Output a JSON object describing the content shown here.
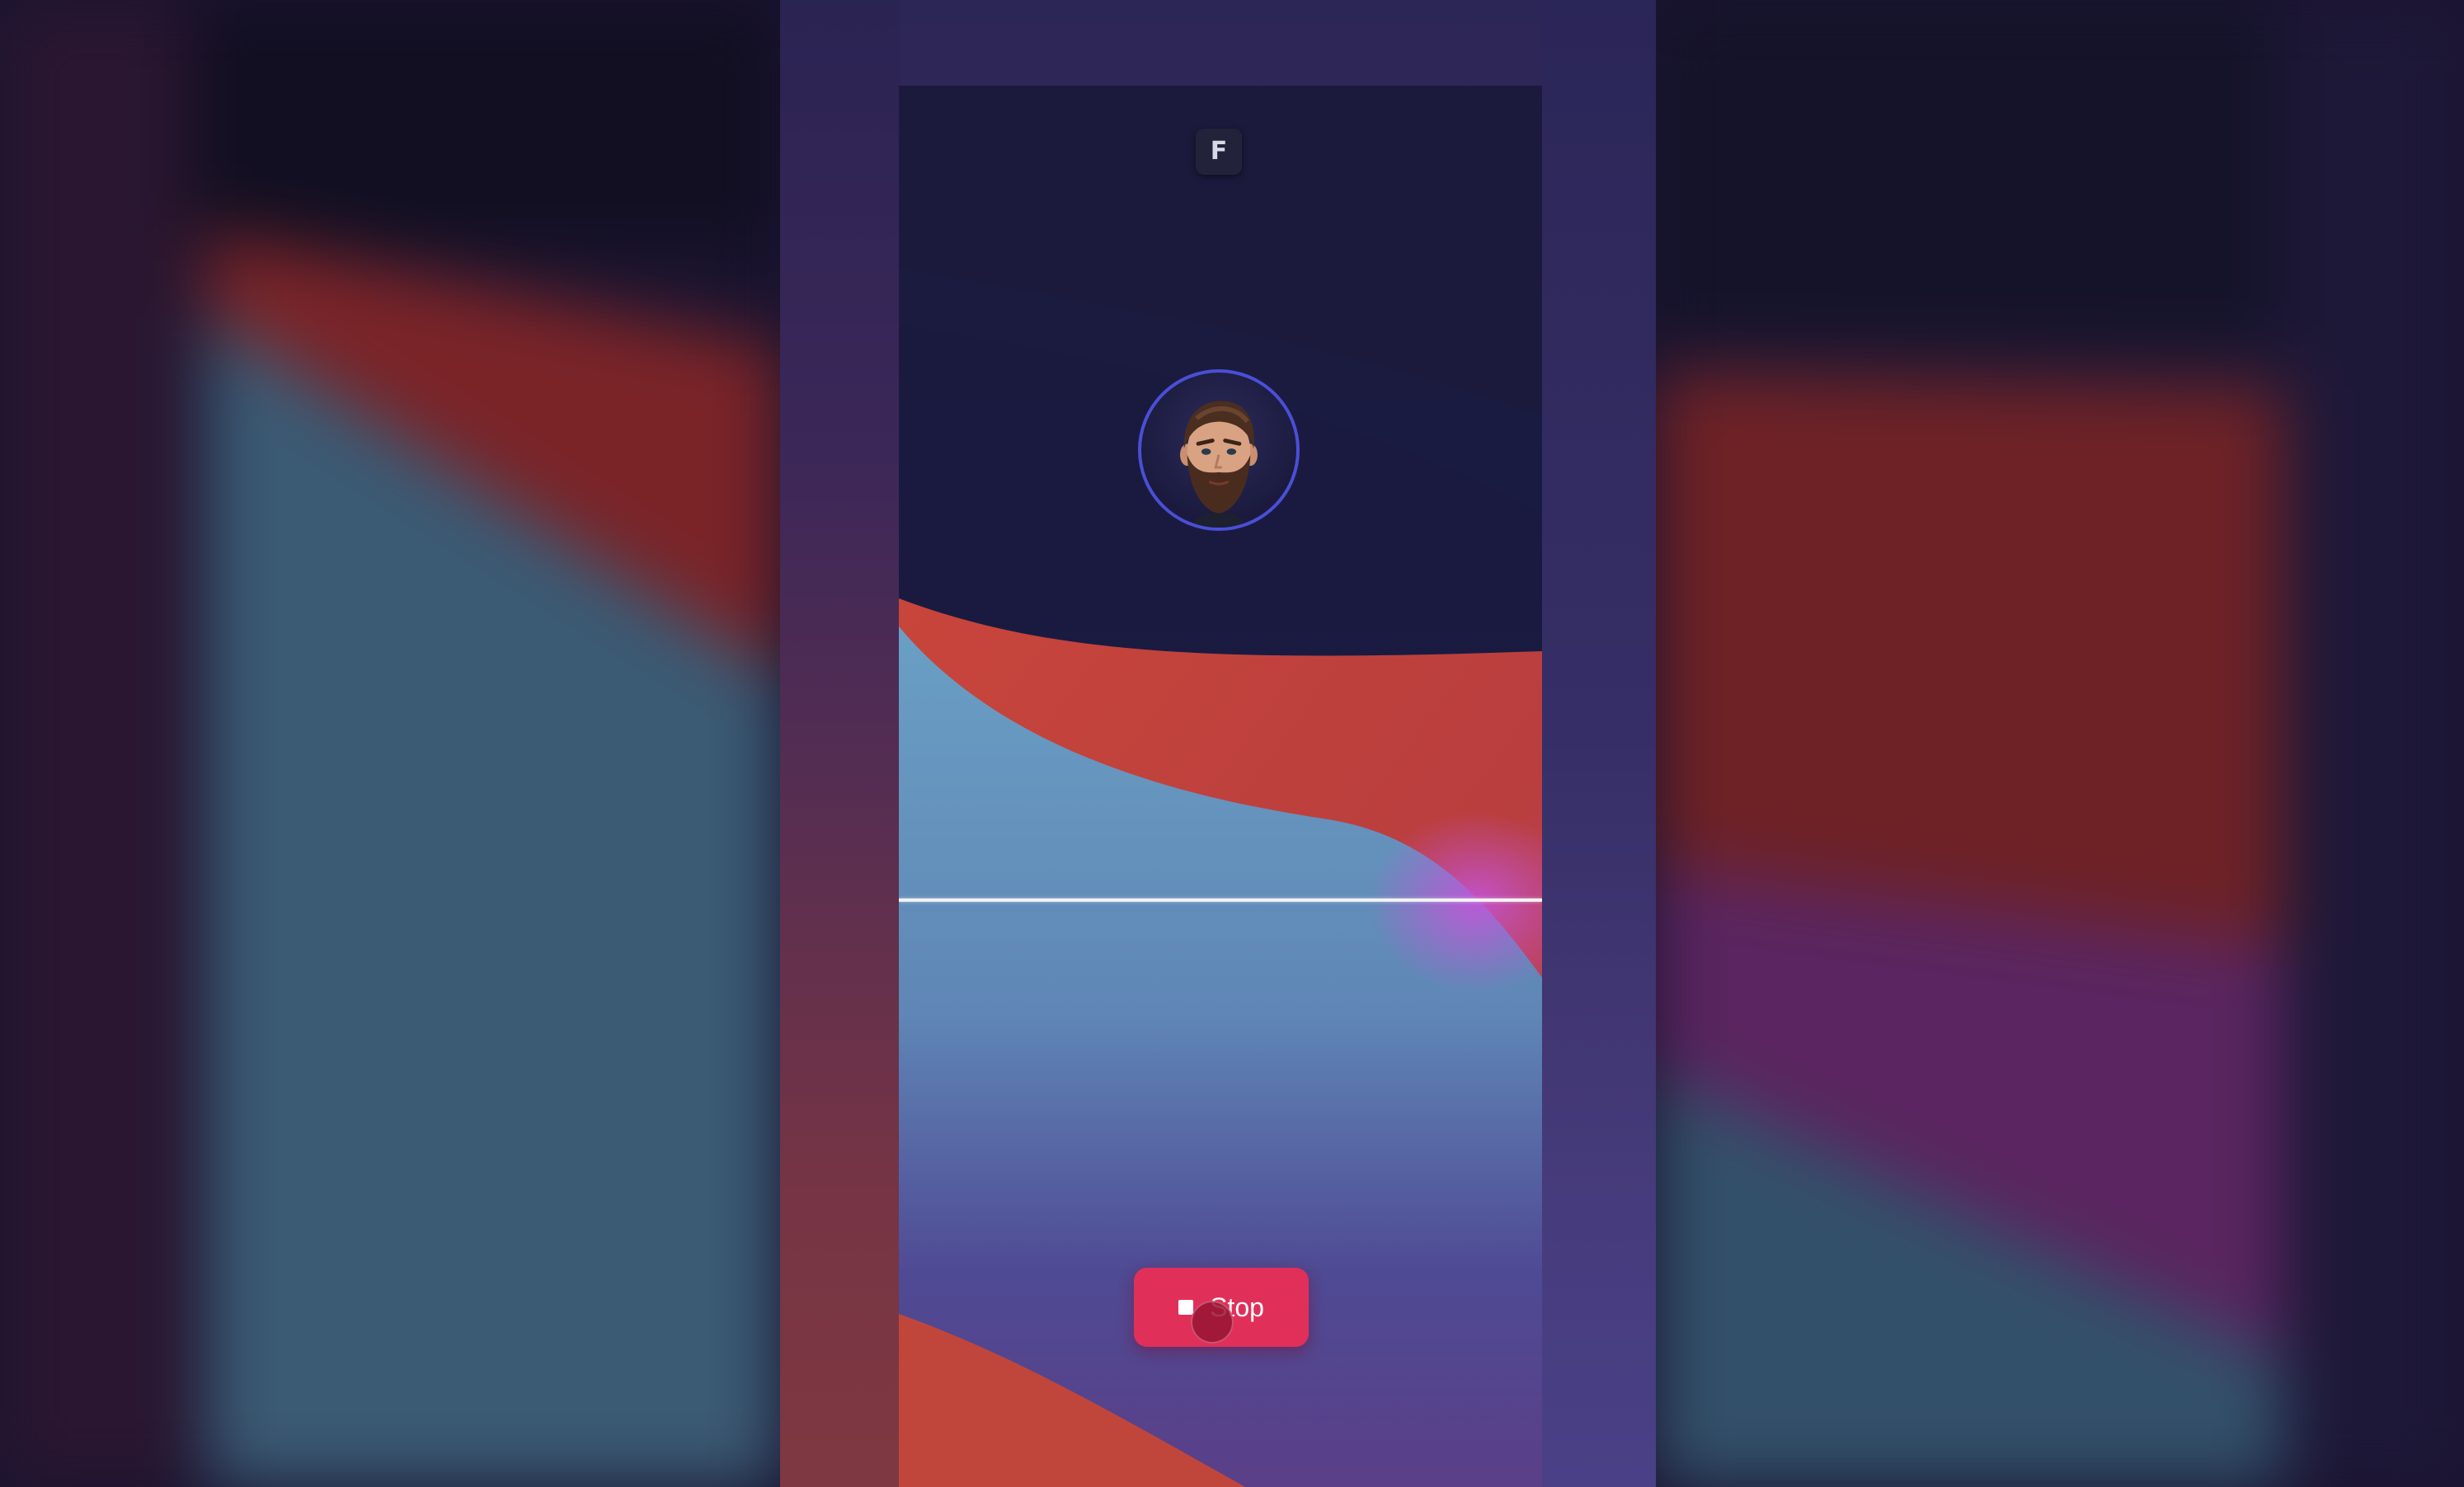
{
  "app": {
    "logo_letter": "F",
    "logo_icon": "app-logo-icon"
  },
  "avatar": {
    "icon": "bearded-man-avatar",
    "ring_color": "#4a4fd6"
  },
  "controls": {
    "stop_label": "Stop",
    "stop_icon": "stop-square-icon",
    "stop_color": "#e0305a"
  },
  "colors": {
    "screen_dark": "#1d1b42",
    "wave_red": "#c9463c",
    "wave_blue": "#6a9cc0",
    "wave_purple": "#5a4a9a",
    "divider": "#f2f2f2"
  }
}
